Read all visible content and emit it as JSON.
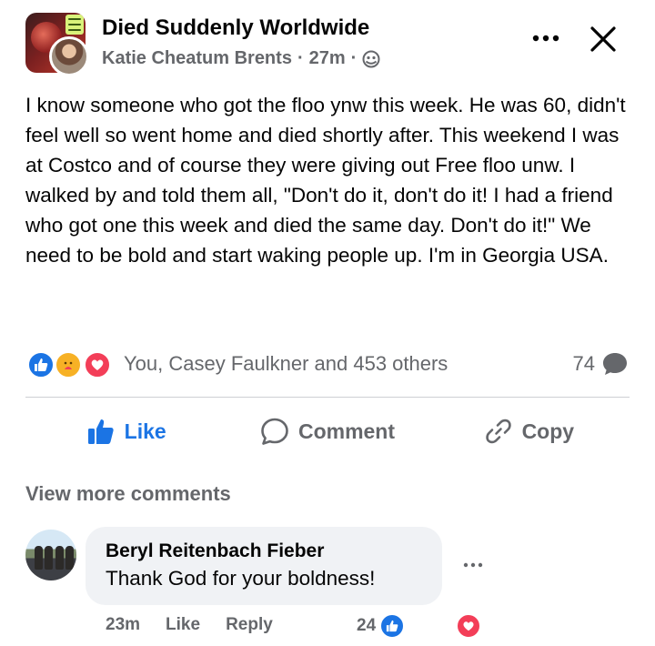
{
  "post": {
    "group_name": "Died Suddenly Worldwide",
    "author": "Katie Cheatum Brents",
    "separator": "·",
    "time": "27m",
    "audience_icon": "globe-icon",
    "body": "I know someone who got the floo ynw this week. He was 60, didn't feel well so went home and died shortly after. This weekend I was at Costco and of course they were giving out Free floo unw. I walked by and told them all, \"Don't do it, don't do it!  I had a friend who got one this week and died the same day. Don't do it!\"  We need to be bold and start waking people up. I'm in Georgia USA."
  },
  "reactions": {
    "icons": [
      "like-icon",
      "care-icon",
      "love-icon"
    ],
    "summary": "You, Casey Faulkner and 453 others",
    "comment_count": "74"
  },
  "actions": {
    "like_label": "Like",
    "comment_label": "Comment",
    "copy_label": "Copy"
  },
  "comments": {
    "view_more_label": "View more comments",
    "items": [
      {
        "author": "Beryl Reitenbach Fieber",
        "text": "Thank God for your boldness!",
        "time": "23m",
        "like_label": "Like",
        "reply_label": "Reply",
        "reaction_count": "24"
      }
    ]
  },
  "colors": {
    "brand_blue": "#1b74e4",
    "love_red": "#f33e58",
    "care_yellow": "#f7b125",
    "secondary_text": "#65676b",
    "bubble_bg": "#f0f2f5"
  }
}
